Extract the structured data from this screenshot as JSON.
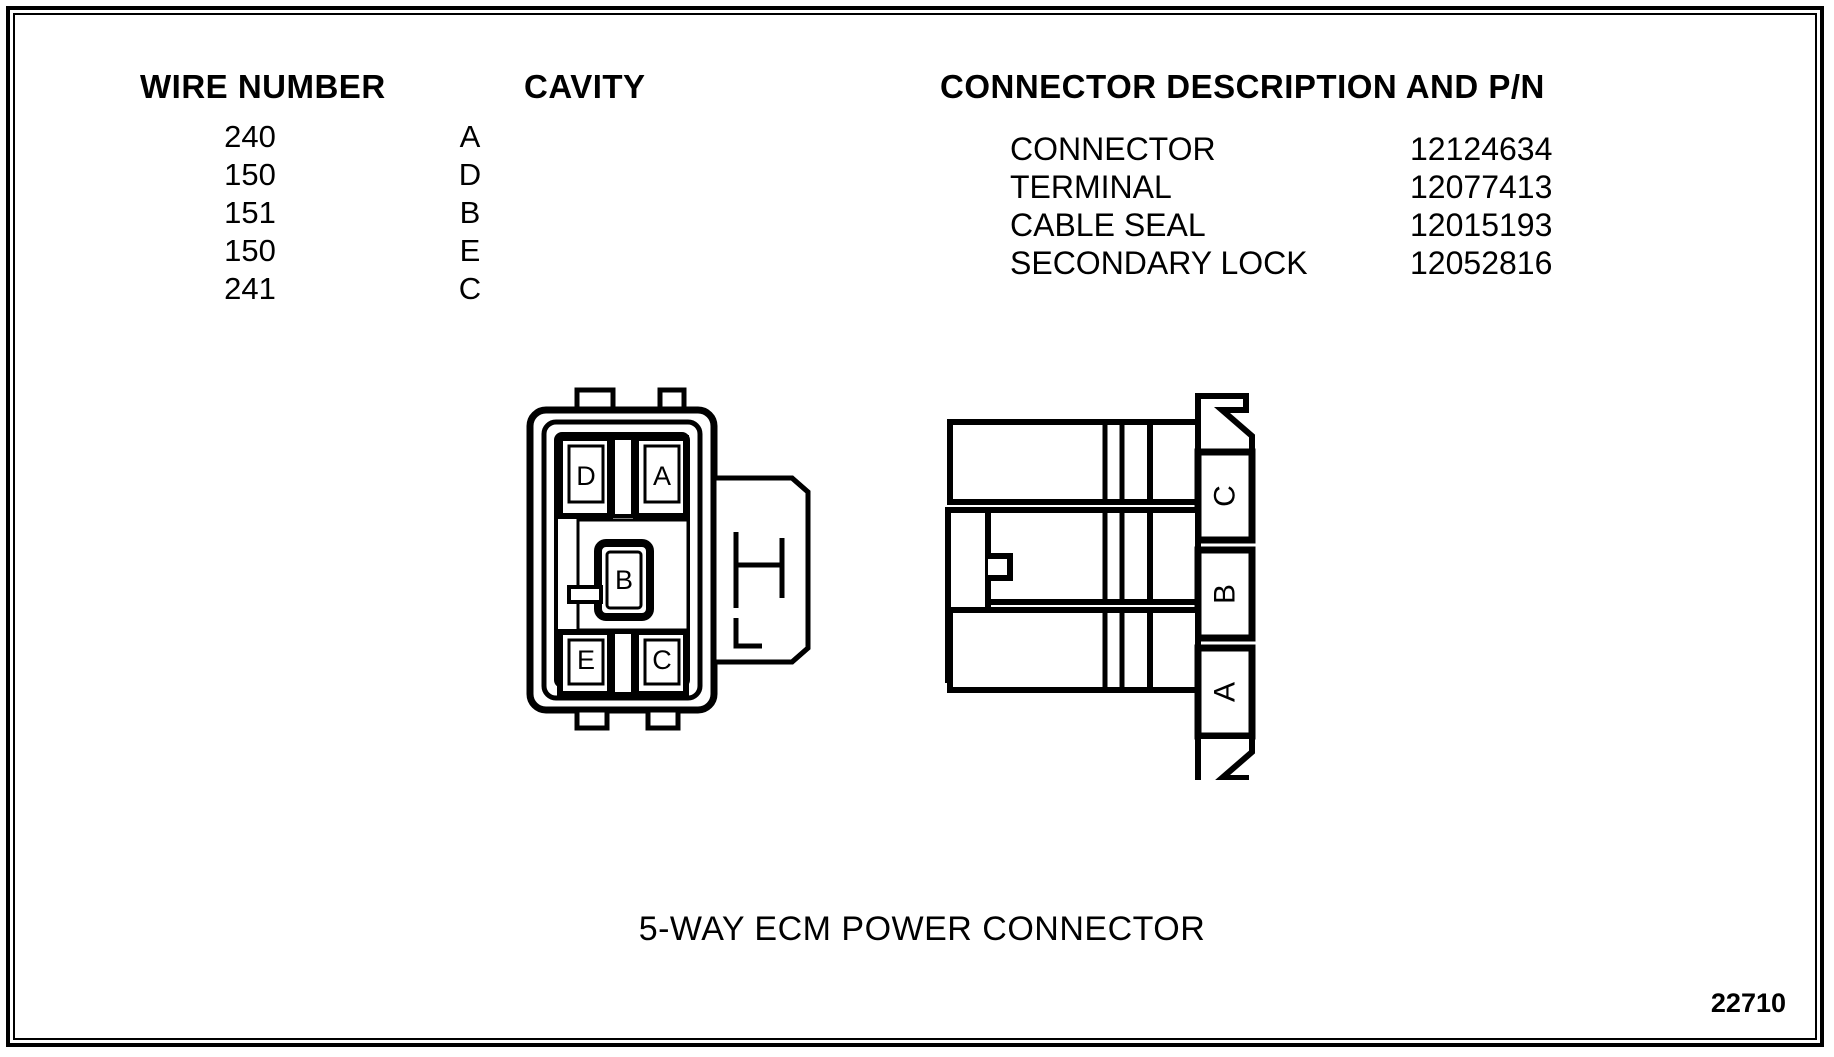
{
  "figure": {
    "caption": "5-WAY ECM POWER CONNECTOR",
    "id": "22710"
  },
  "wire_table": {
    "headers": {
      "wire_number": "WIRE NUMBER",
      "cavity": "CAVITY"
    },
    "rows": [
      {
        "wire": "240",
        "cavity": "A"
      },
      {
        "wire": "150",
        "cavity": "D"
      },
      {
        "wire": "151",
        "cavity": "B"
      },
      {
        "wire": "150",
        "cavity": "E"
      },
      {
        "wire": "241",
        "cavity": "C"
      }
    ]
  },
  "connector_table": {
    "header": "CONNECTOR DESCRIPTION AND P/N",
    "rows": [
      {
        "label": "CONNECTOR",
        "pn": "12124634"
      },
      {
        "label": "TERMINAL",
        "pn": "12077413"
      },
      {
        "label": "CABLE SEAL",
        "pn": "12015193"
      },
      {
        "label": "SECONDARY LOCK",
        "pn": "12052816"
      }
    ]
  },
  "front_view": {
    "cavities": [
      {
        "id": "D"
      },
      {
        "id": "A"
      },
      {
        "id": "B"
      },
      {
        "id": "E"
      },
      {
        "id": "C"
      }
    ]
  },
  "side_view": {
    "cavities": [
      {
        "id": "C"
      },
      {
        "id": "B"
      },
      {
        "id": "A"
      }
    ]
  },
  "colors": {
    "line": "#000000",
    "background": "#ffffff"
  }
}
